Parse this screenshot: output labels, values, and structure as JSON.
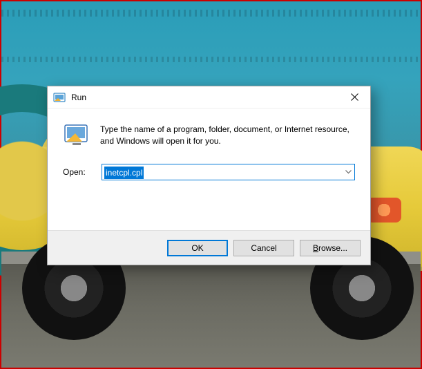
{
  "dialog": {
    "title": "Run",
    "description": "Type the name of a program, folder, document, or Internet resource, and Windows will open it for you.",
    "open_label": "Open:",
    "input_value": "inetcpl.cpl",
    "buttons": {
      "ok": "OK",
      "cancel": "Cancel",
      "browse_prefix": "B",
      "browse_rest": "rowse..."
    }
  },
  "icons": {
    "title_icon": "run-icon",
    "close": "close-icon",
    "large_icon": "run-program-icon",
    "dropdown": "chevron-down-icon"
  }
}
